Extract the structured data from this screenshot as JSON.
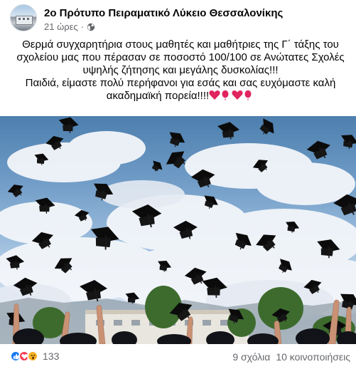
{
  "post": {
    "page_name": "2ο Πρότυπο Πειραματικό Λύκειο Θεσσαλονίκης",
    "time": "21 ώρες",
    "separator": "·",
    "text_line_1": "Θερμά συγχαρητήρια στους μαθητές και μαθήτριες της Γ΄ τάξης του σχολείου μας που πέρασαν σε ποσοστό 100/100 σε Ανώτατες Σχολές υψηλής ζήτησης και μεγάλης δυσκολίας!!!",
    "text_line_2": "Παιδιά, είμαστε πολύ περήφανοι για εσάς και σας ευχόμαστε καλή ακαδημαϊκή πορεία!!!!"
  },
  "footer": {
    "reaction_count": "133",
    "comments": "9 σχόλια",
    "shares": "10 κοινοποιήσεις"
  },
  "icons": {
    "avatar": "school-building-avatar",
    "privacy": "globe-icon",
    "reactions": [
      "like-icon",
      "love-icon",
      "wow-icon"
    ]
  },
  "colors": {
    "like": "#1877f2",
    "love": "#f33e58",
    "wow": "#f7b125",
    "secondary_text": "#65676b"
  }
}
